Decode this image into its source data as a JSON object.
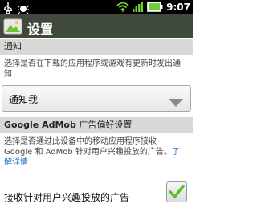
{
  "status_bar": {
    "time": "9:07",
    "icons": [
      "usb-icon",
      "android-debug-icon",
      "wifi-icon",
      "battery-icon"
    ]
  },
  "app": {
    "title": "设置"
  },
  "notification_section": {
    "header": "通知",
    "description": "选择是否在下载的应用程序或游戏有更新时发出通知",
    "spinner": {
      "selected": "通知我"
    }
  },
  "admob_section": {
    "header_bold": "Google AdMob",
    "header_normal": " 广告偏好设置",
    "description": "选择是否通过此设备中的移动应用程序接收 Google 和 AdMob 针对用户兴趣投放的广告。",
    "learn_more": "了解详情",
    "checkbox_label": "接收针对用户兴趣投放的广告",
    "checkbox_checked": true
  },
  "colors": {
    "title_bar": "#3f4a3c",
    "check_mark": "#5bbf2a",
    "link": "#2a6fc9"
  }
}
